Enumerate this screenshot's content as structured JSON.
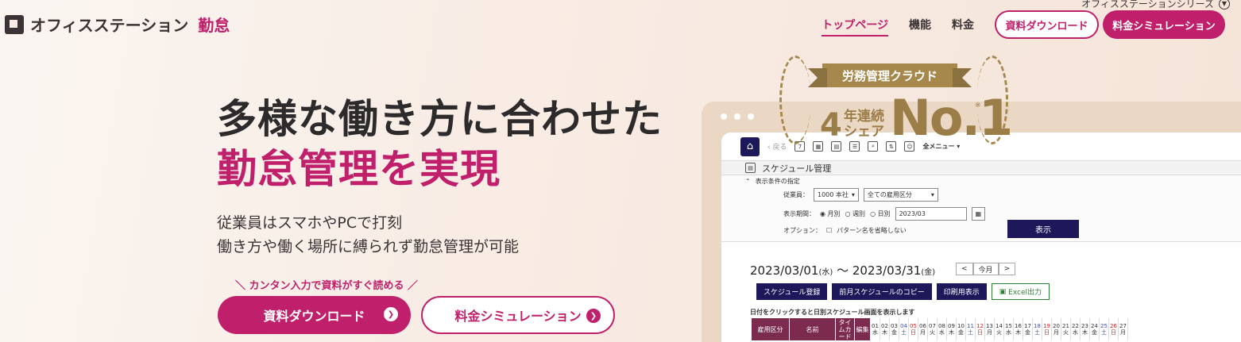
{
  "brand": {
    "name": "オフィスステーション",
    "product": "勤怠"
  },
  "header": {
    "series_label": "オフィスステーションシリーズ",
    "nav": [
      {
        "label": "トップページ",
        "active": true
      },
      {
        "label": "機能",
        "active": false
      },
      {
        "label": "料金",
        "active": false
      }
    ],
    "download_label": "資料ダウンロード",
    "simulation_label": "料金シミュレーション"
  },
  "hero": {
    "title_line1": "多様な働き方に合わせた",
    "title_line2": "勤怠管理を実現",
    "sub_line1": "従業員はスマホやPCで打刻",
    "sub_line2": "働き方や働く場所に縛られず勤怠管理が可能",
    "cta_note": "＼ カンタン入力で資料がすぐ読める ／",
    "cta_download": "資料ダウンロード",
    "cta_simulation": "料金シミュレーション"
  },
  "badge": {
    "ribbon": "労務管理クラウド",
    "years_num": "4",
    "years_line1": "年連続",
    "years_line2": "シェア",
    "rank": "No.1",
    "mark": "※"
  },
  "app": {
    "back_label": "戻る",
    "menu_all": "全メニュー",
    "screen_title": "スケジュール管理",
    "cond_toggle": "表示条件の指定",
    "employee_label": "従業員：",
    "employee_value": "1000 本社",
    "employment_value": "全ての雇用区分",
    "period_label": "表示期間：",
    "period_month": "月別",
    "period_week": "週別",
    "period_day": "日別",
    "period_value": "2023/03",
    "option_label": "オプション：",
    "option_text": "パターン名を省略しない",
    "show_button": "表示",
    "date_from": "2023/03/01",
    "date_from_dow": "(水)",
    "date_sep": "〜",
    "date_to": "2023/03/31",
    "date_to_dow": "(金)",
    "prev": "<",
    "this_month": "今月",
    "next": ">",
    "btn_register": "スケジュール登録",
    "btn_copy": "前月スケジュールのコピー",
    "btn_print": "印刷用表示",
    "btn_excel": "Excel出力",
    "hint": "日付をクリックすると日別スケジュール画面を表示します",
    "col_employment": "雇用区分",
    "col_name": "名前",
    "col_timecard": "タイムカード",
    "col_edit": "編集",
    "days": [
      {
        "d": "01",
        "w": "水",
        "t": ""
      },
      {
        "d": "02",
        "w": "木",
        "t": ""
      },
      {
        "d": "03",
        "w": "金",
        "t": ""
      },
      {
        "d": "04",
        "w": "土",
        "t": "sat"
      },
      {
        "d": "05",
        "w": "日",
        "t": "sun"
      },
      {
        "d": "06",
        "w": "月",
        "t": ""
      },
      {
        "d": "07",
        "w": "火",
        "t": ""
      },
      {
        "d": "08",
        "w": "水",
        "t": ""
      },
      {
        "d": "09",
        "w": "木",
        "t": ""
      },
      {
        "d": "10",
        "w": "金",
        "t": ""
      },
      {
        "d": "11",
        "w": "土",
        "t": "sat"
      },
      {
        "d": "12",
        "w": "日",
        "t": "sun"
      },
      {
        "d": "13",
        "w": "月",
        "t": ""
      },
      {
        "d": "14",
        "w": "火",
        "t": ""
      },
      {
        "d": "15",
        "w": "水",
        "t": ""
      },
      {
        "d": "16",
        "w": "木",
        "t": ""
      },
      {
        "d": "17",
        "w": "金",
        "t": ""
      },
      {
        "d": "18",
        "w": "土",
        "t": "sat"
      },
      {
        "d": "19",
        "w": "日",
        "t": "sun"
      },
      {
        "d": "20",
        "w": "月",
        "t": ""
      },
      {
        "d": "21",
        "w": "火",
        "t": ""
      },
      {
        "d": "22",
        "w": "水",
        "t": ""
      },
      {
        "d": "23",
        "w": "木",
        "t": ""
      },
      {
        "d": "24",
        "w": "金",
        "t": ""
      },
      {
        "d": "25",
        "w": "土",
        "t": "sat"
      },
      {
        "d": "26",
        "w": "日",
        "t": "sun"
      },
      {
        "d": "27",
        "w": "月",
        "t": ""
      }
    ]
  },
  "colors": {
    "brand": "#c01f6b",
    "navy": "#1d1859",
    "gold": "#a6884c"
  }
}
